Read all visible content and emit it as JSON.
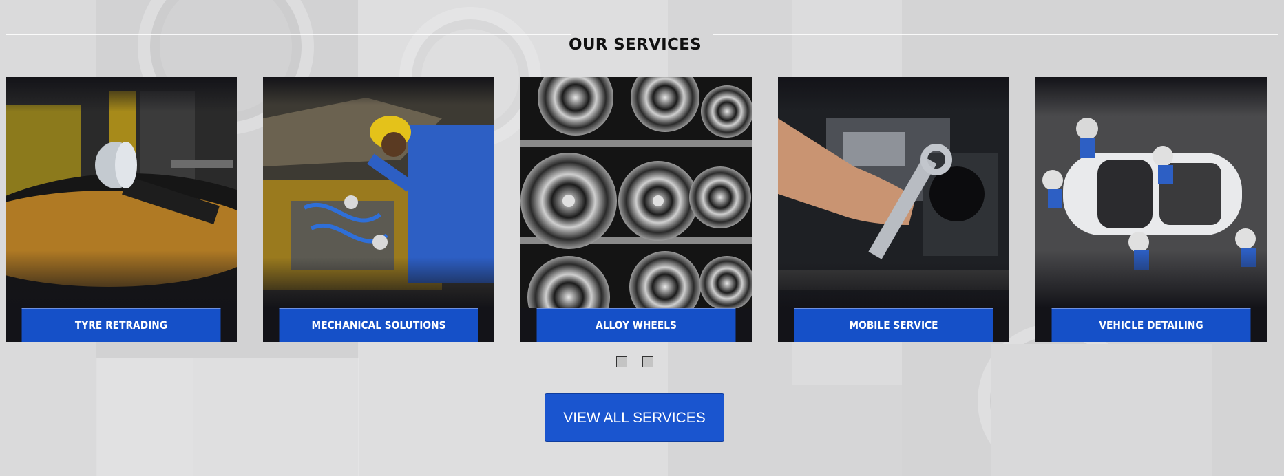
{
  "section": {
    "title": "OUR SERVICES"
  },
  "services": [
    {
      "label": "TYRE RETRADING",
      "image": "tyre-retreading-photo"
    },
    {
      "label": "MECHANICAL SOLUTIONS",
      "image": "mechanic-engine-photo"
    },
    {
      "label": "ALLOY WHEELS",
      "image": "alloy-wheels-rack-photo"
    },
    {
      "label": "MOBILE SERVICE",
      "image": "hand-wrench-engine-photo"
    },
    {
      "label": "VEHICLE DETAILING",
      "image": "car-detailing-top-view-photo"
    }
  ],
  "carousel": {
    "pages": 2
  },
  "cta": {
    "label": "VIEW ALL SERVICES"
  },
  "colors": {
    "accent": "#1550c8",
    "card_background": "#131318",
    "page_background": "#d9d9d9"
  }
}
